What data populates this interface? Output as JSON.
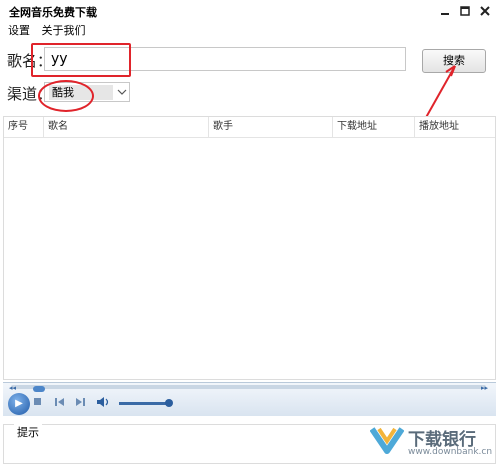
{
  "window": {
    "title": "全网音乐免费下载"
  },
  "menu": {
    "items": [
      "设置",
      "关于我们"
    ]
  },
  "search": {
    "song_label": "歌名：",
    "song_value": "yy",
    "button_label": "搜索"
  },
  "channel": {
    "label": "渠道：",
    "selected": "酷我"
  },
  "table": {
    "columns": [
      "序号",
      "歌名",
      "歌手",
      "下载地址",
      "播放地址"
    ]
  },
  "tips": {
    "label": "提示"
  },
  "watermark": {
    "brand": "下载银行",
    "url": "www.downbank.cn"
  },
  "colors": {
    "annotation_red": "#e0242b",
    "player_blue": "#3a6aa6"
  }
}
